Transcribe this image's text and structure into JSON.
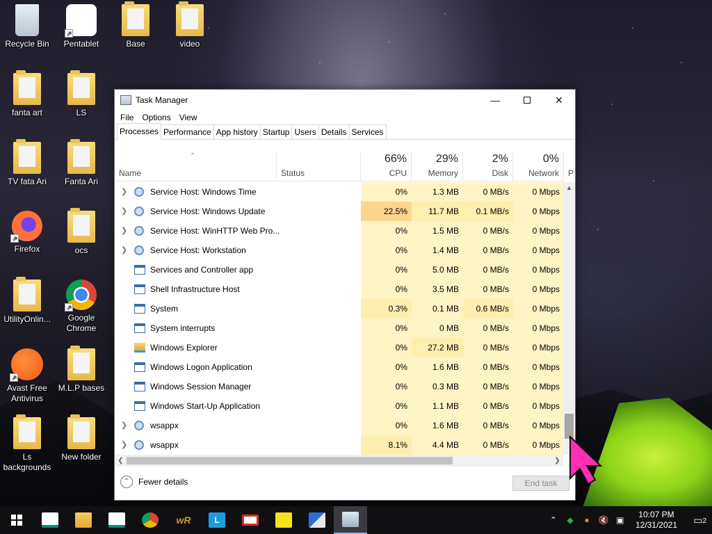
{
  "desktop": {
    "icons": [
      {
        "label": "Recycle Bin",
        "icon": "recycle-bin-icon"
      },
      {
        "label": "Pentablet",
        "icon": "pentablet-icon"
      },
      {
        "label": "Base",
        "icon": "folder-icon"
      },
      {
        "label": "video",
        "icon": "folder-icon"
      },
      {
        "label": "fanta art",
        "icon": "folder-icon"
      },
      {
        "label": "LS",
        "icon": "folder-icon"
      },
      {
        "label": "TV  fata Ari",
        "icon": "folder-icon"
      },
      {
        "label": "Fanta Ari",
        "icon": "folder-icon"
      },
      {
        "label": "Firefox",
        "icon": "firefox-icon"
      },
      {
        "label": "ocs",
        "icon": "folder-icon"
      },
      {
        "label": "UtilityOnlin...",
        "icon": "folder-icon"
      },
      {
        "label": "Google Chrome",
        "icon": "chrome-icon"
      },
      {
        "label": "Avast Free Antivirus",
        "icon": "avast-icon"
      },
      {
        "label": "M.L.P bases",
        "icon": "folder-icon"
      },
      {
        "label": "Ls backgrounds",
        "icon": "folder-icon"
      },
      {
        "label": "New folder",
        "icon": "folder-icon"
      }
    ]
  },
  "taskmanager": {
    "title": "Task Manager",
    "menu": [
      "File",
      "Options",
      "View"
    ],
    "tabs": [
      "Processes",
      "Performance",
      "App history",
      "Startup",
      "Users",
      "Details",
      "Services"
    ],
    "active_tab": "Processes",
    "columns": {
      "name": "Name",
      "status": "Status",
      "cpu": {
        "pct": "66%",
        "label": "CPU"
      },
      "memory": {
        "pct": "29%",
        "label": "Memory"
      },
      "disk": {
        "pct": "2%",
        "label": "Disk"
      },
      "network": {
        "pct": "0%",
        "label": "Network"
      },
      "power_partial": "P"
    },
    "processes": [
      {
        "name": "Service Host: Windows Time",
        "expandable": true,
        "icon": "gear",
        "cpu": "0%",
        "memory": "1.3 MB",
        "disk": "0 MB/s",
        "network": "0 Mbps"
      },
      {
        "name": "Service Host: Windows Update",
        "expandable": true,
        "icon": "gear",
        "cpu": "22.5%",
        "memory": "11.7 MB",
        "disk": "0.1 MB/s",
        "network": "0 Mbps"
      },
      {
        "name": "Service Host: WinHTTP Web Pro...",
        "expandable": true,
        "icon": "gear",
        "cpu": "0%",
        "memory": "1.5 MB",
        "disk": "0 MB/s",
        "network": "0 Mbps"
      },
      {
        "name": "Service Host: Workstation",
        "expandable": true,
        "icon": "gear",
        "cpu": "0%",
        "memory": "1.4 MB",
        "disk": "0 MB/s",
        "network": "0 Mbps"
      },
      {
        "name": "Services and Controller app",
        "expandable": false,
        "icon": "win",
        "cpu": "0%",
        "memory": "5.0 MB",
        "disk": "0 MB/s",
        "network": "0 Mbps"
      },
      {
        "name": "Shell Infrastructure Host",
        "expandable": false,
        "icon": "win",
        "cpu": "0%",
        "memory": "3.5 MB",
        "disk": "0 MB/s",
        "network": "0 Mbps"
      },
      {
        "name": "System",
        "expandable": false,
        "icon": "win",
        "cpu": "0.3%",
        "memory": "0.1 MB",
        "disk": "0.6 MB/s",
        "network": "0 Mbps"
      },
      {
        "name": "System interrupts",
        "expandable": false,
        "icon": "win",
        "cpu": "0%",
        "memory": "0 MB",
        "disk": "0 MB/s",
        "network": "0 Mbps"
      },
      {
        "name": "Windows Explorer",
        "expandable": false,
        "icon": "fold",
        "cpu": "0%",
        "memory": "27.2 MB",
        "disk": "0 MB/s",
        "network": "0 Mbps"
      },
      {
        "name": "Windows Logon Application",
        "expandable": false,
        "icon": "win",
        "cpu": "0%",
        "memory": "1.6 MB",
        "disk": "0 MB/s",
        "network": "0 Mbps"
      },
      {
        "name": "Windows Session Manager",
        "expandable": false,
        "icon": "win",
        "cpu": "0%",
        "memory": "0.3 MB",
        "disk": "0 MB/s",
        "network": "0 Mbps"
      },
      {
        "name": "Windows Start-Up Application",
        "expandable": false,
        "icon": "win",
        "cpu": "0%",
        "memory": "1.1 MB",
        "disk": "0 MB/s",
        "network": "0 Mbps"
      },
      {
        "name": "wsappx",
        "expandable": true,
        "icon": "gear",
        "cpu": "0%",
        "memory": "1.6 MB",
        "disk": "0 MB/s",
        "network": "0 Mbps"
      },
      {
        "name": "wsappx",
        "expandable": true,
        "icon": "gear",
        "cpu": "8.1%",
        "memory": "4.4 MB",
        "disk": "0 MB/s",
        "network": "0 Mbps"
      }
    ],
    "footer": {
      "fewer_details": "Fewer details",
      "end_task": "End task"
    }
  },
  "taskbar": {
    "apps": [
      "windows-start-icon",
      "ca-icon",
      "file-explorer-icon",
      "ca-icon",
      "chrome-icon",
      "wr-icon",
      "l-app-icon",
      "gmail-icon",
      "sticky-notes-icon",
      "translator-icon",
      "task-manager-icon"
    ],
    "clock_time": "10:07 PM",
    "clock_date": "12/31/2021",
    "notification_count": "2"
  },
  "colors": {
    "cpu_hot": "#fdd58d",
    "cell_bg": "#fff4c4",
    "accent": "#8ab4f8",
    "cursor": "#ff2fb4"
  }
}
